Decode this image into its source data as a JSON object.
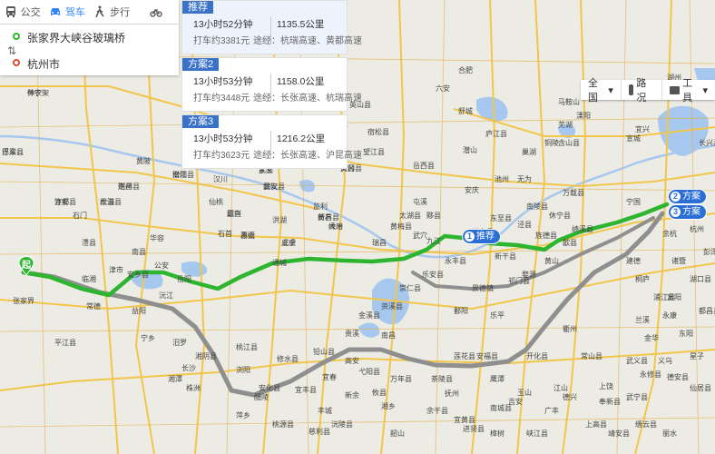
{
  "modes": [
    {
      "label": "公交",
      "icon": "bus-icon"
    },
    {
      "label": "驾车",
      "icon": "car-icon"
    },
    {
      "label": "步行",
      "icon": "walk-icon"
    },
    {
      "label": "",
      "icon": "bike-icon"
    }
  ],
  "active_mode": 1,
  "route": {
    "start": "张家界大峡谷玻璃桥",
    "end": "杭州市"
  },
  "plans": [
    {
      "tag": "推荐",
      "time": "13小时52分钟",
      "dist": "1135.5公里",
      "taxi": "打车约3381元",
      "via": "途经：杭瑞高速、黄都高速"
    },
    {
      "tag": "方案2",
      "time": "13小时53分钟",
      "dist": "1158.0公里",
      "taxi": "打车约3448元",
      "via": "途经：长张高速、杭瑞高速"
    },
    {
      "tag": "方案3",
      "time": "13小时53分钟",
      "dist": "1216.2公里",
      "taxi": "打车约3623元",
      "via": "途经：长张高速、沪昆高速"
    }
  ],
  "controls": {
    "area": "全国",
    "traffic": "路况",
    "tools": "工具"
  },
  "map_badges": {
    "recommend": "推荐",
    "plan2": "方案",
    "plan3": "方案",
    "plan2_no": "2",
    "plan3_no": "3",
    "rec_no": "1"
  },
  "start_pin_label": "起",
  "colors": {
    "route_green": "#2db530",
    "alt_grey": "#8f8f8f",
    "accent": "#3385ff",
    "tag": "#3a72c8",
    "water": "#a6c8ef"
  },
  "cities": [
    "巴东县",
    "神农架",
    "张家界",
    "常德",
    "安乡县",
    "岳阳",
    "武汉",
    "咸宁",
    "黄石",
    "黄冈",
    "安庆",
    "池州",
    "东至县",
    "景德镇",
    "黄山",
    "马鞍山",
    "芜湖",
    "南昌",
    "萍乡",
    "株洲",
    "湘潭",
    "长沙",
    "宜春",
    "新余",
    "抚州",
    "上饶",
    "衢州",
    "金华",
    "义乌",
    "杭州",
    "宜城",
    "宣城",
    "湖州",
    "荆州",
    "荆门",
    "汉川",
    "麻城",
    "六安",
    "合肥",
    "铜陵",
    "九江",
    "修水县",
    "宜丰县",
    "浏阳",
    "丰城",
    "余干县",
    "鹰潭",
    "宜黄县",
    "南城县",
    "武义县",
    "永康",
    "江山",
    "兰溪",
    "柳城县",
    "沅陵县",
    "淮北",
    "大冶",
    "蕲春",
    "通城",
    "平江",
    "天门",
    "孝感",
    "孝昌",
    "屯溪",
    "祁门县",
    "石台县",
    "歙县",
    "婺源",
    "乐平",
    "德兴",
    "万载",
    "分宜",
    "上栗",
    "醴陵",
    "宁乡",
    "沅江",
    "南县",
    "华容",
    "临湘",
    "赤壁",
    "嘉鱼",
    "仙桃",
    "潜江",
    "监利",
    "石首",
    "公安",
    "松滋",
    "澧县",
    "津市",
    "石门",
    "临澧",
    "桃源",
    "慈利",
    "桑植",
    "鹤峰"
  ],
  "city_labels": [
    {
      "t": "巴东县"
    },
    {
      "t": "神农架"
    },
    {
      "t": "宜都"
    },
    {
      "t": "松滋"
    },
    {
      "t": "荆州"
    },
    {
      "t": "潜江"
    },
    {
      "t": "天门"
    },
    {
      "t": "孝感"
    },
    {
      "t": "武汉"
    },
    {
      "t": "黄冈"
    },
    {
      "t": "黄石"
    },
    {
      "t": "大冶"
    },
    {
      "t": "咸宁"
    },
    {
      "t": "嘉鱼"
    },
    {
      "t": "赤壁"
    },
    {
      "t": "通城"
    },
    {
      "t": "岳阳"
    },
    {
      "t": "华容"
    },
    {
      "t": "安乡县"
    },
    {
      "t": "南县"
    },
    {
      "t": "津市"
    },
    {
      "t": "澧县"
    },
    {
      "t": "石门"
    },
    {
      "t": "常德"
    },
    {
      "t": "张家界"
    },
    {
      "t": "沅江"
    },
    {
      "t": "益阳"
    },
    {
      "t": "宁乡"
    },
    {
      "t": "长沙"
    },
    {
      "t": "湘潭"
    },
    {
      "t": "株洲"
    },
    {
      "t": "浏阳"
    },
    {
      "t": "醴陵"
    },
    {
      "t": "萍乡"
    },
    {
      "t": "宜春"
    },
    {
      "t": "新余"
    },
    {
      "t": "宜丰县"
    },
    {
      "t": "修水县"
    },
    {
      "t": "高安"
    },
    {
      "t": "南昌"
    },
    {
      "t": "丰城"
    },
    {
      "t": "抚州"
    },
    {
      "t": "宜黄县"
    },
    {
      "t": "南城县"
    },
    {
      "t": "鹰潭"
    },
    {
      "t": "上饶"
    },
    {
      "t": "德兴"
    },
    {
      "t": "婺源"
    },
    {
      "t": "乐平"
    },
    {
      "t": "景德镇"
    },
    {
      "t": "鄱阳"
    },
    {
      "t": "九江"
    },
    {
      "t": "瑞昌"
    },
    {
      "t": "武穴"
    },
    {
      "t": "黄梅县"
    },
    {
      "t": "安庆"
    },
    {
      "t": "池州"
    },
    {
      "t": "东至县"
    },
    {
      "t": "石台县"
    },
    {
      "t": "祁门县"
    },
    {
      "t": "黄山"
    },
    {
      "t": "歙县"
    },
    {
      "t": "铜陵"
    },
    {
      "t": "芜湖"
    },
    {
      "t": "马鞍山"
    },
    {
      "t": "合肥"
    },
    {
      "t": "六安"
    },
    {
      "t": "舒城"
    },
    {
      "t": "庐江县"
    },
    {
      "t": "潜山"
    },
    {
      "t": "岳西县"
    },
    {
      "t": "宣城"
    },
    {
      "t": "宁国"
    },
    {
      "t": "湖州"
    },
    {
      "t": "杭州"
    },
    {
      "t": "富阳"
    },
    {
      "t": "桐庐"
    },
    {
      "t": "建德"
    },
    {
      "t": "兰溪"
    },
    {
      "t": "金华"
    },
    {
      "t": "义乌"
    },
    {
      "t": "永康"
    },
    {
      "t": "武义县"
    },
    {
      "t": "衢州"
    },
    {
      "t": "常山县"
    },
    {
      "t": "江山"
    },
    {
      "t": "开化县"
    },
    {
      "t": "玉山"
    },
    {
      "t": "广丰"
    },
    {
      "t": "丽水"
    },
    {
      "t": "缙云县"
    },
    {
      "t": "仙居县"
    },
    {
      "t": "东阳"
    },
    {
      "t": "浦江县"
    },
    {
      "t": "诸暨"
    },
    {
      "t": "余杭"
    },
    {
      "t": "安吉县"
    },
    {
      "t": "长兴县"
    },
    {
      "t": "宜兴"
    },
    {
      "t": "溧阳"
    },
    {
      "t": "含山县"
    },
    {
      "t": "巢湖"
    },
    {
      "t": "无为"
    },
    {
      "t": "南陵县"
    },
    {
      "t": "泾县"
    },
    {
      "t": "旌德县"
    },
    {
      "t": "绩溪县"
    },
    {
      "t": "休宁县"
    },
    {
      "t": "屯溪"
    },
    {
      "t": "黟县"
    },
    {
      "t": "太湖县"
    },
    {
      "t": "宿松县"
    },
    {
      "t": "望江县"
    },
    {
      "t": "英山县"
    },
    {
      "t": "罗田县"
    },
    {
      "t": "麻城"
    },
    {
      "t": "红安县"
    },
    {
      "t": "新洲"
    },
    {
      "t": "黄陂"
    },
    {
      "t": "汉川"
    },
    {
      "t": "仙桃"
    },
    {
      "t": "监利"
    },
    {
      "t": "洪湖"
    },
    {
      "t": "石首"
    },
    {
      "t": "公安"
    },
    {
      "t": "临湘"
    },
    {
      "t": "平江县"
    },
    {
      "t": "汨罗"
    },
    {
      "t": "湘阴县"
    },
    {
      "t": "桃江县"
    },
    {
      "t": "安化县"
    },
    {
      "t": "桃源县"
    },
    {
      "t": "慈利县"
    },
    {
      "t": "沅陵县"
    },
    {
      "t": "湘乡"
    },
    {
      "t": "韶山"
    },
    {
      "t": "攸县"
    },
    {
      "t": "茶陵县"
    },
    {
      "t": "莲花县"
    },
    {
      "t": "安福县"
    },
    {
      "t": "吉安"
    },
    {
      "t": "峡江县"
    },
    {
      "t": "樟树"
    },
    {
      "t": "进贤县"
    },
    {
      "t": "余干县"
    },
    {
      "t": "万年县"
    },
    {
      "t": "弋阳县"
    },
    {
      "t": "铅山县"
    },
    {
      "t": "贵溪"
    },
    {
      "t": "金溪县"
    },
    {
      "t": "资溪县"
    },
    {
      "t": "崇仁县"
    },
    {
      "t": "乐安县"
    },
    {
      "t": "永丰县"
    },
    {
      "t": "新干县"
    },
    {
      "t": "万载县"
    },
    {
      "t": "上高县"
    },
    {
      "t": "奉新县"
    },
    {
      "t": "靖安县"
    },
    {
      "t": "武宁县"
    },
    {
      "t": "永修县"
    },
    {
      "t": "德安县"
    },
    {
      "t": "星子"
    },
    {
      "t": "都昌县"
    },
    {
      "t": "湖口县"
    },
    {
      "t": "彭泽县"
    },
    {
      "t": "浮梁县"
    },
    {
      "t": "休宁"
    },
    {
      "t": "淳安县"
    },
    {
      "t": "龙游县"
    },
    {
      "t": "遂昌县"
    },
    {
      "t": "松阳县"
    },
    {
      "t": "云和县"
    },
    {
      "t": "武义"
    },
    {
      "t": "磐安县"
    },
    {
      "t": "天台县"
    },
    {
      "t": "新昌县"
    },
    {
      "t": "嵊州"
    },
    {
      "t": "上虞"
    },
    {
      "t": "绍兴"
    },
    {
      "t": "萧山"
    }
  ]
}
